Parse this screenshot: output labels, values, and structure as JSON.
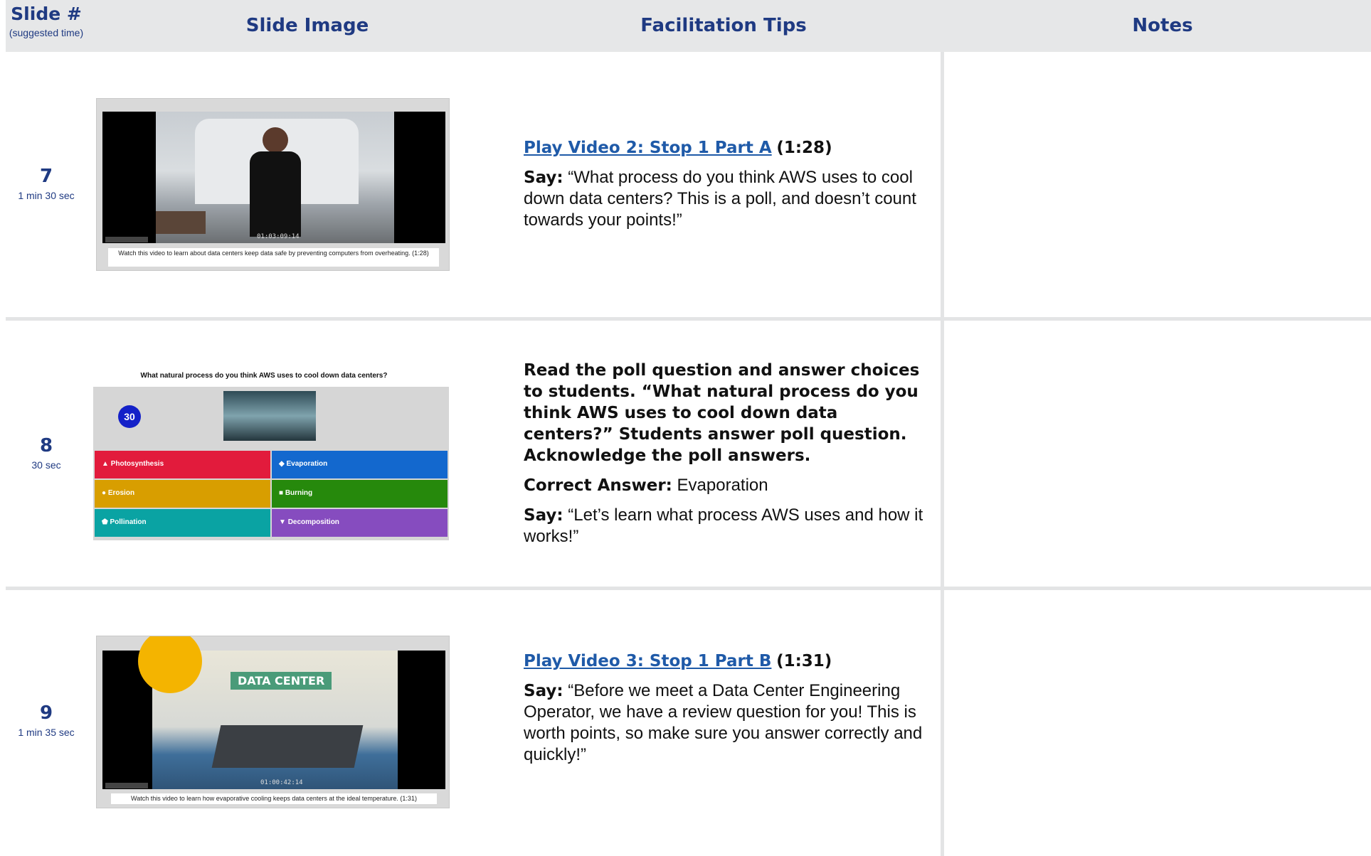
{
  "header": {
    "slide_col": "Slide #",
    "slide_col_sub": "(suggested time)",
    "image_col": "Slide Image",
    "tips_col": "Facilitation Tips",
    "notes_col": "Notes"
  },
  "rows": [
    {
      "number": "7",
      "duration": "1 min 30 sec",
      "thumb": {
        "timecode": "01:03:09:14",
        "caption": "Watch this video to learn about data centers keep data safe by preventing computers from overheating. (1:28)"
      },
      "tips": {
        "link": "Play Video 2: Stop 1 Part A",
        "link_time": "(1:28)",
        "say_label": "Say:",
        "say_text": "“What process do you think AWS uses to cool down data centers? This is a poll, and doesn’t count towards your points!”"
      }
    },
    {
      "number": "8",
      "duration": "30 sec",
      "thumb": {
        "question": "What natural process do you think AWS uses to cool down data centers?",
        "timer": "30",
        "answers": [
          {
            "label": "Photosynthesis",
            "symbol": "▲",
            "color": "#e21b3c"
          },
          {
            "label": "Evaporation",
            "symbol": "◆",
            "color": "#1368ce"
          },
          {
            "label": "Erosion",
            "symbol": "●",
            "color": "#d89e00"
          },
          {
            "label": "Burning",
            "symbol": "■",
            "color": "#26890c"
          },
          {
            "label": "Pollination",
            "symbol": "⬟",
            "color": "#0aa3a3"
          },
          {
            "label": "Decomposition",
            "symbol": "▼",
            "color": "#864cbf"
          }
        ]
      },
      "tips": {
        "instruction": "Read the poll question and answer choices to students. “What natural process do you think AWS uses to cool down data centers?” Students answer poll question. Acknowledge the poll answers.",
        "answer_label": "Correct Answer:",
        "answer_text": "Evaporation",
        "say_label": "Say:",
        "say_text": "“Let’s learn what process AWS uses and how it works!”"
      }
    },
    {
      "number": "9",
      "duration": "1 min 35 sec",
      "thumb": {
        "label": "DATA CENTER",
        "timecode": "01:00:42:14",
        "caption": "Watch this video to learn how evaporative cooling keeps data centers at the ideal temperature. (1:31)"
      },
      "tips": {
        "link": "Play Video 3: Stop 1 Part B",
        "link_time": "(1:31)",
        "say_label": "Say:",
        "say_text": "“Before we meet a Data Center Engineering Operator, we have a review question for you! This is worth points, so make sure you answer correctly and quickly!”"
      }
    }
  ]
}
